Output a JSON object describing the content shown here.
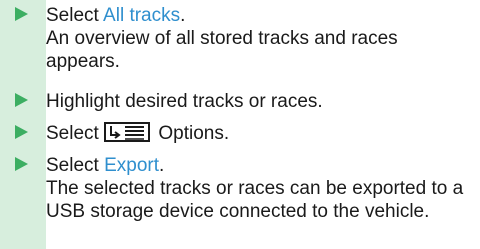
{
  "colors": {
    "marker_band": "#d7eedd",
    "triangle": "#3cae62",
    "link": "#2f8fce",
    "text": "#1a1a1a"
  },
  "steps": [
    {
      "pre": "Select ",
      "link": "All tracks",
      "post": ".",
      "result": "An overview of all stored tracks and races appears."
    },
    {
      "text": "Highlight desired tracks or races."
    },
    {
      "pre": "Select ",
      "icon": "options-menu-icon",
      "post": " Options."
    },
    {
      "pre": "Select ",
      "link": "Export",
      "post": ".",
      "result": "The selected tracks or races can be exported to a USB storage device connected to the vehicle."
    }
  ]
}
